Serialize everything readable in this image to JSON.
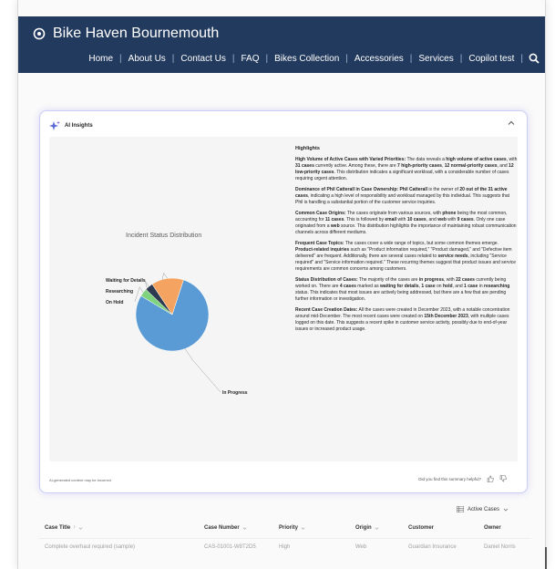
{
  "site": {
    "title": "Bike Haven Bournemouth"
  },
  "nav": {
    "items": [
      "Home",
      "About Us",
      "Contact Us",
      "FAQ",
      "Bikes Collection",
      "Accessories",
      "Services",
      "Copilot test"
    ]
  },
  "insights": {
    "header": "AI Insights",
    "footer_disclaimer": "AI-generated content may be incorrect",
    "feedback_prompt": "Did you find this summary helpful?",
    "highlights_title": "Highlights",
    "paragraphs": [
      {
        "title": "High Volume of Active Cases with Varied Priorities:",
        "segments": [
          " The data reveals a ",
          {
            "b": "high volume of active cases"
          },
          ", with ",
          {
            "b": "31 cases"
          },
          " currently active. Among these, there are ",
          {
            "b": "7 high-priority cases"
          },
          ", ",
          {
            "b": "12 normal-priority cases"
          },
          ", and ",
          {
            "b": "12 low-priority cases"
          },
          ". This distribution indicates a significant workload, with a considerable number of cases requiring urgent attention."
        ]
      },
      {
        "title": "Dominance of Phil Catterall in Case Ownership: Phil Catterall",
        "segments": [
          " is the owner of ",
          {
            "b": "20 out of the 31 active cases"
          },
          ", indicating a high level of responsibility and workload managed by this individual. This suggests that Phil is handling a substantial portion of the customer service inquiries."
        ]
      },
      {
        "title": "Common Case Origins:",
        "segments": [
          " The cases originate from various sources, with ",
          {
            "b": "phone"
          },
          " being the most common, accounting for ",
          {
            "b": "11 cases"
          },
          ". This is followed by ",
          {
            "b": "email"
          },
          " with ",
          {
            "b": "10 cases"
          },
          ", and ",
          {
            "b": "web"
          },
          " with ",
          {
            "b": "9 cases"
          },
          ". Only one case originated from a ",
          {
            "b": "web"
          },
          " source. This distribution highlights the importance of maintaining robust communication channels across different mediums."
        ]
      },
      {
        "title": "Frequent Case Topics:",
        "segments": [
          " The cases cover a wide range of topics, but some common themes emerge. ",
          {
            "b": "Product-related inquiries"
          },
          " such as \"Product information required,\" \"Product damaged,\" and \"Defective item delivered\" are frequent. Additionally, there are several cases related to ",
          {
            "b": "service needs"
          },
          ", including \"Service required\" and \"Service information required.\" These recurring themes suggest that product issues and service requirements are common concerns among customers."
        ]
      },
      {
        "title": "Status Distribution of Cases:",
        "segments": [
          " The majority of the cases are ",
          {
            "b": "in progress"
          },
          ", with ",
          {
            "b": "22 cases"
          },
          " currently being worked on. There are ",
          {
            "b": "4 cases"
          },
          " marked as ",
          {
            "b": "waiting for details"
          },
          ", ",
          {
            "b": "1 case"
          },
          " on ",
          {
            "b": "hold"
          },
          ", and ",
          {
            "b": "1 case"
          },
          " in ",
          {
            "b": "researching"
          },
          " status. This indicates that most issues are actively being addressed, but there are a few that are pending further information or investigation."
        ]
      },
      {
        "title": "Recent Case Creation Dates:",
        "segments": [
          " All the cases were created in December 2023, with a notable concentration around mid-December. The most recent cases were created on ",
          {
            "b": "15th December 2023"
          },
          ", with multiple cases logged on this date. This suggests a recent spike in customer service activity, possibly due to end-of-year issues or increased product usage."
        ]
      }
    ]
  },
  "chart_data": {
    "type": "pie",
    "title": "Incident Status Distribution",
    "categories": [
      "In Progress",
      "Waiting for Details",
      "Researching",
      "On Hold"
    ],
    "values": [
      22,
      4,
      1,
      1
    ],
    "colors": [
      "#5b9bd5",
      "#f4a460",
      "#2e3a4f",
      "#7fd37f"
    ]
  },
  "table": {
    "view_label": "Active Cases",
    "columns": [
      "Case Title",
      "Case Number",
      "Priority",
      "Origin",
      "Customer",
      "Owner"
    ],
    "rows": [
      [
        "Complete overhaul required (sample)",
        "CAS-01001-W8T2D5",
        "High",
        "Web",
        "Guardian Insurance",
        "Daniel Norris"
      ]
    ]
  },
  "icons": {
    "brand": "bike-logo-icon",
    "search": "search-icon",
    "sparkle": "sparkle-icon",
    "collapse": "chevron-up-icon",
    "thumbs_up": "thumbs-up-icon",
    "thumbs_down": "thumbs-down-icon",
    "grid": "grid-icon"
  }
}
